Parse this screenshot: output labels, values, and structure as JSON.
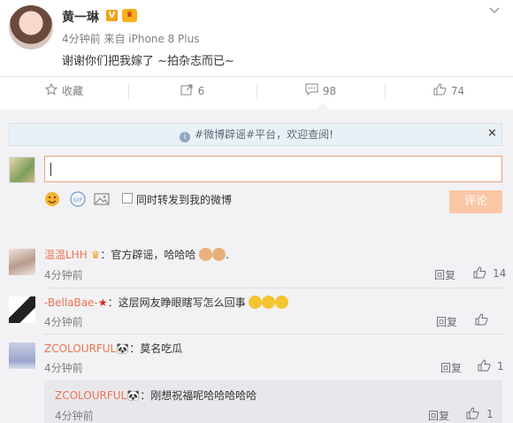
{
  "post": {
    "author": "黄一琳",
    "v_badge": "V",
    "crown_badge": "♛",
    "meta": "4分钟前 来自 iPhone 8 Plus",
    "text": "谢谢你们把我嫁了 ~拍杂志而已~"
  },
  "actions": {
    "favorite": "收藏",
    "repost_count": "6",
    "comment_count": "98",
    "like_count": "74"
  },
  "notice": {
    "text": "#微博辟谣#平台，欢迎查阅!",
    "close": "×"
  },
  "composer": {
    "input_value": "",
    "forward_label": "同时转发到我的微博",
    "submit_label": "评论"
  },
  "comments": [
    {
      "name": "温温LHH",
      "badge": "♛",
      "text": "：官方辟谣，哈哈哈",
      "time": "4分钟前",
      "reply": "回复",
      "likes": "14"
    },
    {
      "name": "-BellaBae-",
      "badge": "★",
      "text": "：这层网友睁眼瞎写怎么回事",
      "time": "4分钟前",
      "reply": "回复",
      "likes": ""
    },
    {
      "name": "ZCOLOURFUL",
      "badge": "🐼",
      "text": "：莫名吃瓜",
      "time": "4分钟前",
      "reply": "回复",
      "likes": "1"
    }
  ],
  "sub_reply": {
    "name": "ZCOLOURFUL",
    "badge": "🐼",
    "text": "：刚想祝福呢哈哈哈哈哈",
    "time": "4分钟前",
    "reply": "回复",
    "likes": "1"
  },
  "colors": {
    "name_link": "#eb7350",
    "submit_disabled": "#fbc6a6",
    "notice_bg": "#eaf1f6"
  }
}
